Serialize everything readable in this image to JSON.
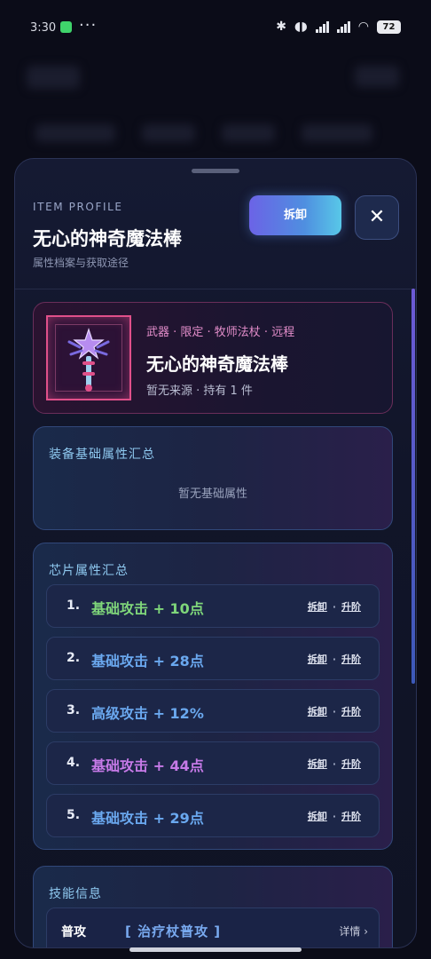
{
  "status_bar": {
    "time": "3:30",
    "battery": "72"
  },
  "sheet": {
    "kicker": "ITEM PROFILE",
    "title": "无心的神奇魔法棒",
    "subtitle": "属性档案与获取途径",
    "unequip_label": "拆卸",
    "close_icon": "close-icon"
  },
  "item": {
    "tags": "武器 · 限定 · 牧师法杖 · 远程",
    "name": "无心的神奇魔法棒",
    "source": "暂无来源 · 持有 1 件",
    "frame_color": "#e0508a"
  },
  "base_stats": {
    "title": "装备基础属性汇总",
    "empty_text": "暂无基础属性"
  },
  "chips": {
    "title": "芯片属性汇总",
    "unequip_label": "拆卸",
    "separator": "·",
    "upgrade_label": "升阶",
    "items": [
      {
        "index": "1.",
        "text": "基础攻击 + 10点",
        "color": "#7fd67a"
      },
      {
        "index": "2.",
        "text": "基础攻击 + 28点",
        "color": "#6aa8ef"
      },
      {
        "index": "3.",
        "text": "高级攻击 + 12%",
        "color": "#6aa8ef"
      },
      {
        "index": "4.",
        "text": "基础攻击 + 44点",
        "color": "#c77ae8"
      },
      {
        "index": "5.",
        "text": "基础攻击 + 29点",
        "color": "#6aa8ef"
      }
    ]
  },
  "skills": {
    "title": "技能信息",
    "rows": [
      {
        "type": "普攻",
        "name": "[ 治疗杖普攻 ]",
        "detail": "详情 ›"
      }
    ]
  },
  "colors": {
    "accent_gradient_start": "#6b63e6",
    "accent_gradient_end": "#58c8e8",
    "background": "#0b0c18"
  }
}
